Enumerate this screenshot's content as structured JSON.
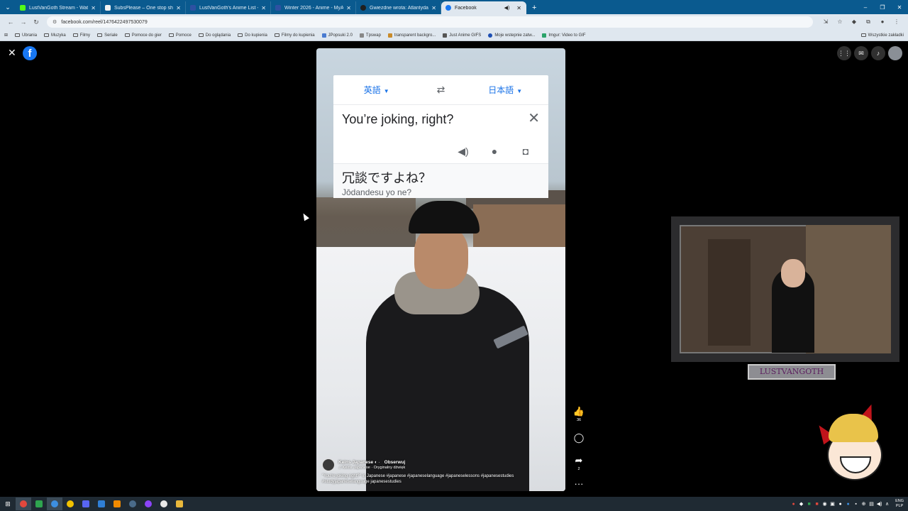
{
  "browser": {
    "tabs": [
      {
        "label": "LustVanGoth Stream - Watch Li",
        "color": "#53fc18"
      },
      {
        "label": "SubsPlease – One stop shop fo",
        "color": "#f2f2f2"
      },
      {
        "label": "LustVanGoth's Anime List - My",
        "color": "#2e51a2"
      },
      {
        "label": "Winter 2026 - Anime - MyAnim",
        "color": "#2e51a2"
      },
      {
        "label": "Gwiezdne wrota: Atlantyda / St",
        "color": "#202020"
      },
      {
        "label": "Facebook",
        "color": "#1877f2",
        "active": true
      }
    ],
    "url": "facebook.com/reel/1476422497530079",
    "bookmarks": [
      {
        "label": "Ubrania",
        "type": "folder"
      },
      {
        "label": "Muzyka",
        "type": "folder"
      },
      {
        "label": "Filmy",
        "type": "folder"
      },
      {
        "label": "Seriale",
        "type": "folder"
      },
      {
        "label": "Pomoce do gier",
        "type": "folder"
      },
      {
        "label": "Pomoce",
        "type": "folder"
      },
      {
        "label": "Do oglądania",
        "type": "folder"
      },
      {
        "label": "Do kupienia",
        "type": "folder"
      },
      {
        "label": "Filmy do kupienia",
        "type": "folder"
      },
      {
        "label": "JPopsuki 2.0",
        "type": "site",
        "color": "#4a7bd0"
      },
      {
        "label": "Tpswap",
        "type": "site",
        "color": "#888888"
      },
      {
        "label": "transparent backgro...",
        "type": "site",
        "color": "#c98b2a"
      },
      {
        "label": "Just Anime GIFS",
        "type": "site",
        "color": "#555555"
      },
      {
        "label": "Moje wstepnie zatw...",
        "type": "site",
        "color": "#1e4fb3"
      },
      {
        "label": "Imgur: Video to GIF",
        "type": "site",
        "color": "#2ba36a"
      }
    ],
    "bookmarks_right": "Wszystkie zakładki"
  },
  "reel": {
    "translate": {
      "source_lang": "英語",
      "target_lang": "日本語",
      "source_text": "You’re joking, right?",
      "target_text": "冗談ですよね？",
      "romanization": "Jōdandesu yo ne?"
    },
    "author": "Keins Japanese",
    "follow": "Obserwuj",
    "audio": "Keins Japanese · Oryginalny dźwięk",
    "caption": "\"You're joking right?\" in Japanese #japanese #japaneselanguage #japaneselessons #japanesestudies #studyjapaneselanguage japanesestudies",
    "likes": "36",
    "shares": "2"
  },
  "overlay": {
    "cam_name": "LUSTVANGOTH"
  },
  "tray": {
    "lang_top": "ENG",
    "lang_bottom": "PLP"
  },
  "colors": {
    "facebook_blue": "#1877f2",
    "translate_blue": "#1a73e8",
    "tab_strip": "#0a5a8f"
  }
}
